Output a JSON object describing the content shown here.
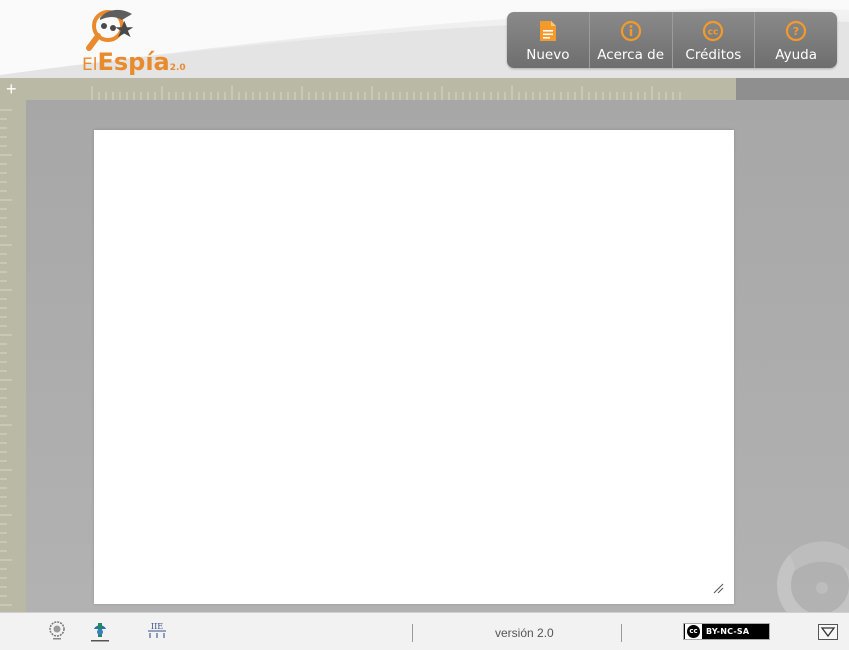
{
  "app": {
    "logo_el": "El",
    "logo_name": "Espía",
    "logo_version": "2.0"
  },
  "toolbar": {
    "items": [
      {
        "label": "Nuevo",
        "icon": "document-icon"
      },
      {
        "label": "Acerca de",
        "icon": "info-icon"
      },
      {
        "label": "Créditos",
        "icon": "cc-icon"
      },
      {
        "label": "Ayuda",
        "icon": "help-icon"
      }
    ]
  },
  "footer": {
    "version": "versión 2.0",
    "license": "BY-NC-SA",
    "cc_mark": "cc",
    "logos": [
      "institution-seal-logo",
      "education-ministry-logo",
      "iie-logo"
    ]
  },
  "colors": {
    "brand_orange": "#e98a2d",
    "toolbar_gray": "#7c7c7c",
    "ruler": "#b9b9a6",
    "workspace": "#ababab"
  }
}
